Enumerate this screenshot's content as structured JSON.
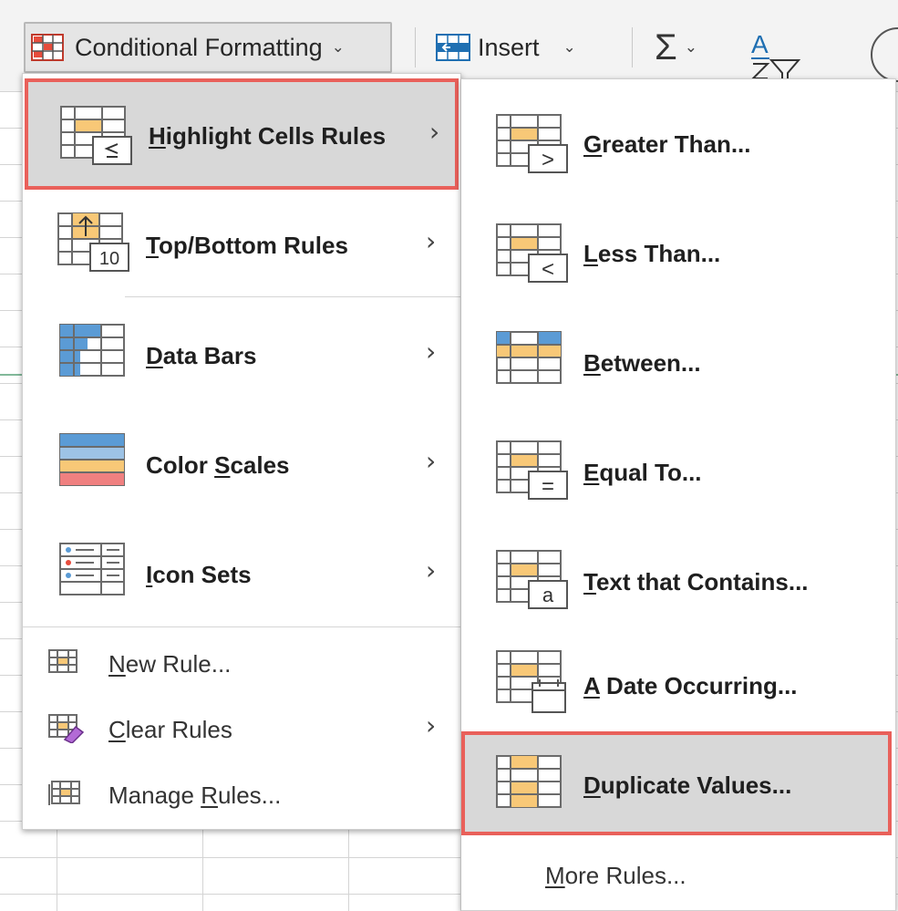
{
  "ribbon": {
    "conditional_formatting": {
      "label": "Conditional Formatting"
    },
    "insert": {
      "label": "Insert"
    },
    "sum_symbol": "Σ",
    "sort_letter": "A"
  },
  "left_menu": {
    "items": [
      {
        "pre": "",
        "key": "H",
        "post": "ighlight Cells Rules",
        "icon": "highlight-cells-rules-icon",
        "has_submenu": true,
        "highlighted": true
      },
      {
        "pre": "",
        "key": "T",
        "post": "op/Bottom Rules",
        "icon": "top-bottom-rules-icon",
        "icon_text": "10",
        "has_submenu": true
      },
      {
        "pre": "",
        "key": "D",
        "post": "ata Bars",
        "icon": "data-bars-icon",
        "has_submenu": true
      },
      {
        "pre": "Color ",
        "key": "S",
        "post": "cales",
        "icon": "color-scales-icon",
        "has_submenu": true
      },
      {
        "pre": "",
        "key": "I",
        "post": "con Sets",
        "icon": "icon-sets-icon",
        "has_submenu": true
      }
    ],
    "bottom_items": [
      {
        "pre": "",
        "key": "N",
        "post": "ew Rule...",
        "icon": "new-rule-icon"
      },
      {
        "pre": "",
        "key": "C",
        "post": "lear Rules",
        "icon": "clear-rules-icon",
        "has_submenu": true
      },
      {
        "pre": "Manage ",
        "key": "R",
        "post": "ules...",
        "icon": "manage-rules-icon"
      }
    ]
  },
  "right_menu": {
    "items": [
      {
        "pre": "",
        "key": "G",
        "post": "reater Than...",
        "icon": "greater-than-icon",
        "icon_text": ">"
      },
      {
        "pre": "",
        "key": "L",
        "post": "ess Than...",
        "icon": "less-than-icon",
        "icon_text": "<"
      },
      {
        "pre": "",
        "key": "B",
        "post": "etween...",
        "icon": "between-icon"
      },
      {
        "pre": "",
        "key": "E",
        "post": "qual To...",
        "icon": "equal-to-icon",
        "icon_text": "="
      },
      {
        "pre": "",
        "key": "T",
        "post": "ext that Contains...",
        "icon": "text-contains-icon",
        "icon_text": "a"
      },
      {
        "pre": "",
        "key": "A",
        "post": " Date Occurring...",
        "icon": "date-occurring-icon"
      },
      {
        "pre": "",
        "key": "D",
        "post": "uplicate Values...",
        "icon": "duplicate-values-icon",
        "highlighted": true
      }
    ],
    "more_rules": {
      "pre": "",
      "key": "M",
      "post": "ore Rules..."
    }
  },
  "chevron": "›",
  "colors": {
    "highlight_border": "#e9605a",
    "highlight_fill": "#d8d8d8",
    "orange_cell": "#f8c877",
    "blue_cell": "#5b9bd5",
    "red_cell": "#f08080"
  }
}
